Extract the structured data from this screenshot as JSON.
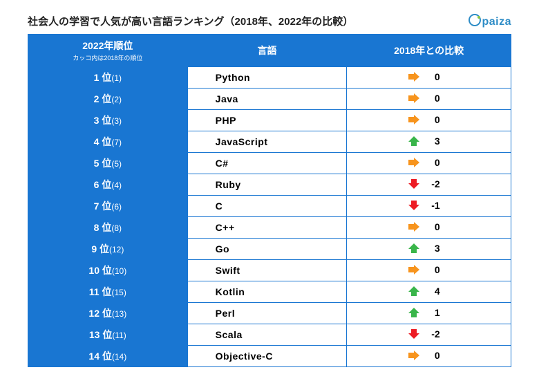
{
  "title": "社会人の学習で人気が高い言語ランキング（2018年、2022年の比較）",
  "logo_text": "paiza",
  "columns": {
    "rank": "2022年順位",
    "rank_sub": "カッコ内は2018年の順位",
    "language": "言語",
    "comparison": "2018年との比較"
  },
  "rank_suffix": " 位",
  "rows": [
    {
      "rank2022": 1,
      "rank2018": 1,
      "language": "Python",
      "delta": 0,
      "dir": "same"
    },
    {
      "rank2022": 2,
      "rank2018": 2,
      "language": "Java",
      "delta": 0,
      "dir": "same"
    },
    {
      "rank2022": 3,
      "rank2018": 3,
      "language": "PHP",
      "delta": 0,
      "dir": "same"
    },
    {
      "rank2022": 4,
      "rank2018": 7,
      "language": "JavaScript",
      "delta": 3,
      "dir": "up"
    },
    {
      "rank2022": 5,
      "rank2018": 5,
      "language": "C#",
      "delta": 0,
      "dir": "same"
    },
    {
      "rank2022": 6,
      "rank2018": 4,
      "language": "Ruby",
      "delta": -2,
      "dir": "down"
    },
    {
      "rank2022": 7,
      "rank2018": 6,
      "language": "C",
      "delta": -1,
      "dir": "down"
    },
    {
      "rank2022": 8,
      "rank2018": 8,
      "language": "C++",
      "delta": 0,
      "dir": "same"
    },
    {
      "rank2022": 9,
      "rank2018": 12,
      "language": "Go",
      "delta": 3,
      "dir": "up"
    },
    {
      "rank2022": 10,
      "rank2018": 10,
      "language": "Swift",
      "delta": 0,
      "dir": "same"
    },
    {
      "rank2022": 11,
      "rank2018": 15,
      "language": "Kotlin",
      "delta": 4,
      "dir": "up"
    },
    {
      "rank2022": 12,
      "rank2018": 13,
      "language": "Perl",
      "delta": 1,
      "dir": "up"
    },
    {
      "rank2022": 13,
      "rank2018": 11,
      "language": "Scala",
      "delta": -2,
      "dir": "down"
    },
    {
      "rank2022": 14,
      "rank2018": 14,
      "language": "Objective-C",
      "delta": 0,
      "dir": "same"
    }
  ],
  "chart_data": {
    "type": "table",
    "title": "社会人の学習で人気が高い言語ランキング（2018年、2022年の比較）",
    "columns": [
      "2022年順位",
      "2018年順位",
      "言語",
      "2018年との比較"
    ],
    "rows": [
      [
        1,
        1,
        "Python",
        0
      ],
      [
        2,
        2,
        "Java",
        0
      ],
      [
        3,
        3,
        "PHP",
        0
      ],
      [
        4,
        7,
        "JavaScript",
        3
      ],
      [
        5,
        5,
        "C#",
        0
      ],
      [
        6,
        4,
        "Ruby",
        -2
      ],
      [
        7,
        6,
        "C",
        -1
      ],
      [
        8,
        8,
        "C++",
        0
      ],
      [
        9,
        12,
        "Go",
        3
      ],
      [
        10,
        10,
        "Swift",
        0
      ],
      [
        11,
        15,
        "Kotlin",
        4
      ],
      [
        12,
        13,
        "Perl",
        1
      ],
      [
        13,
        11,
        "Scala",
        -2
      ],
      [
        14,
        14,
        "Objective-C",
        0
      ]
    ]
  }
}
